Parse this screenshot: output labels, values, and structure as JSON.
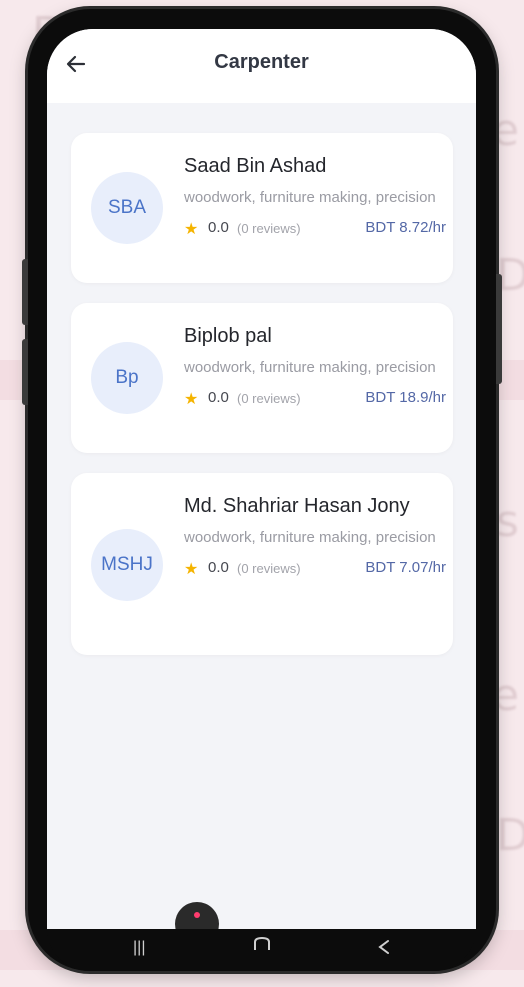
{
  "appbar": {
    "title": "Carpenter",
    "back_icon": "arrow-left-icon"
  },
  "providers": [
    {
      "initials": "SBA",
      "name": "Saad Bin Ashad",
      "skills": "woodwork, furniture making, precision",
      "rating": "0.0",
      "reviews": "(0 reviews)",
      "rate": "BDT 8.72/hr"
    },
    {
      "initials": "Bp",
      "name": "Biplob pal",
      "skills": "woodwork, furniture making, precision",
      "rating": "0.0",
      "reviews": "(0 reviews)",
      "rate": "BDT 18.9/hr"
    },
    {
      "initials": "MSHJ",
      "name": "Md. Shahriar Hasan Jony",
      "skills": "woodwork, furniture making, precision",
      "rating": "0.0",
      "reviews": "(0 reviews)",
      "rate": "BDT 7.07/hr"
    }
  ],
  "nav": {
    "recents_icon": "recents-icon",
    "home_icon": "home-icon",
    "back_icon": "back-icon"
  },
  "colors": {
    "accent": "#5468a6",
    "avatar_bg": "#e8eefb",
    "avatar_text": "#4b74c8",
    "star": "#f5b400",
    "screen_bg": "#f3f4f8"
  }
}
